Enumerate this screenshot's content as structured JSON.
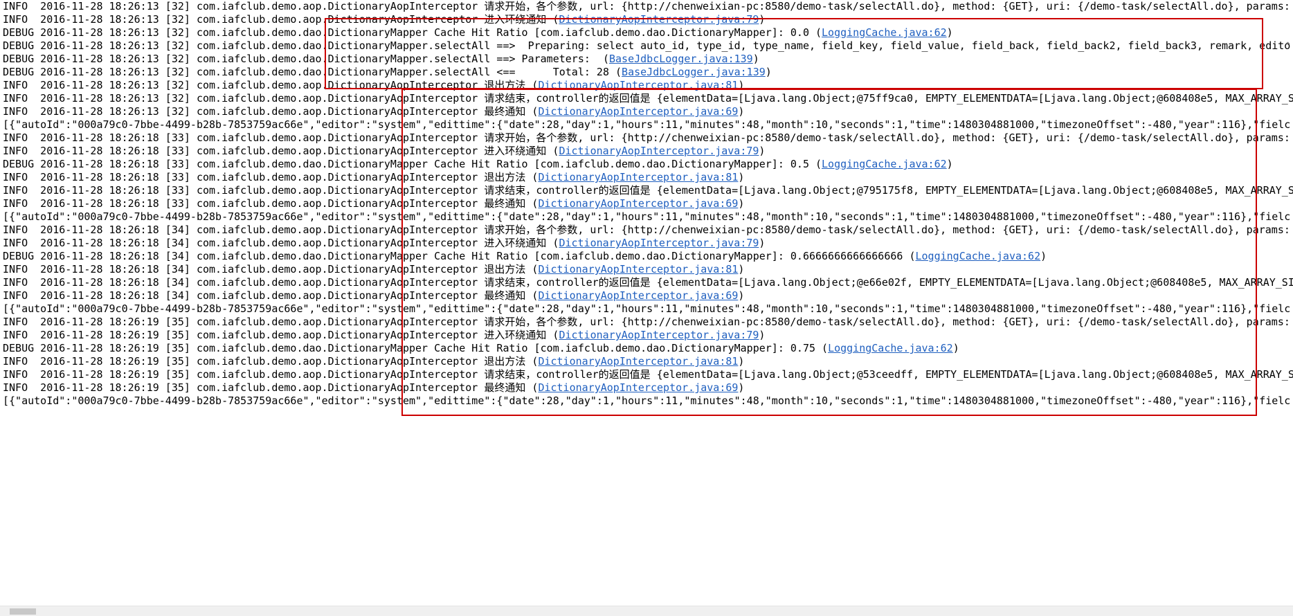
{
  "lines": [
    {
      "prefix": "INFO  2016-11-28 18:26:13 [32] com.iafclub.demo.aop.DictionaryAopInterceptor 请求开始，各个参数, url: {http://chenweixian-pc:8580/demo-task/selectAll.do}, method: {GET}, uri: {/demo-task/selectAll.do}, params: {",
      "link": "",
      "suffix": ""
    },
    {
      "prefix": "INFO  2016-11-28 18:26:13 [32] com.iafclub.demo.aop.DictionaryAopInterceptor 进入环绕通知 (",
      "link": "DictionaryAopInterceptor.java:79",
      "suffix": ")"
    },
    {
      "prefix": "DEBUG 2016-11-28 18:26:13 [32] com.iafclub.demo.dao.DictionaryMapper Cache Hit Ratio [com.iafclub.demo.dao.DictionaryMapper]: 0.0 (",
      "link": "LoggingCache.java:62",
      "suffix": ")"
    },
    {
      "prefix": "DEBUG 2016-11-28 18:26:13 [32] com.iafclub.demo.dao.DictionaryMapper.selectAll ==>  Preparing: select auto_id, type_id, type_name, field_key, field_value, field_back, field_back2, field_back3, remark, edito",
      "link": "",
      "suffix": ""
    },
    {
      "prefix": "DEBUG 2016-11-28 18:26:13 [32] com.iafclub.demo.dao.DictionaryMapper.selectAll ==> Parameters:  (",
      "link": "BaseJdbcLogger.java:139",
      "suffix": ")"
    },
    {
      "prefix": "DEBUG 2016-11-28 18:26:13 [32] com.iafclub.demo.dao.DictionaryMapper.selectAll <==      Total: 28 (",
      "link": "BaseJdbcLogger.java:139",
      "suffix": ")"
    },
    {
      "prefix": "INFO  2016-11-28 18:26:13 [32] com.iafclub.demo.aop.DictionaryAopInterceptor 退出方法 (",
      "link": "DictionaryAopInterceptor.java:81",
      "suffix": ")"
    },
    {
      "prefix": "INFO  2016-11-28 18:26:13 [32] com.iafclub.demo.aop.DictionaryAopInterceptor 请求结束，controller的返回值是 {elementData=[Ljava.lang.Object;@75ff9ca0, EMPTY_ELEMENTDATA=[Ljava.lang.Object;@608408e5, MAX_ARRAY_SIZE",
      "link": "",
      "suffix": ""
    },
    {
      "prefix": "INFO  2016-11-28 18:26:13 [32] com.iafclub.demo.aop.DictionaryAopInterceptor 最终通知 (",
      "link": "DictionaryAopInterceptor.java:69",
      "suffix": ")"
    },
    {
      "prefix": "[{\"autoId\":\"000a79c0-7bbe-4499-b28b-7853759ac66e\",\"editor\":\"system\",\"edittime\":{\"date\":28,\"day\":1,\"hours\":11,\"minutes\":48,\"month\":10,\"seconds\":1,\"time\":1480304881000,\"timezoneOffset\":-480,\"year\":116},\"fielc",
      "link": "",
      "suffix": ""
    },
    {
      "prefix": "INFO  2016-11-28 18:26:18 [33] com.iafclub.demo.aop.DictionaryAopInterceptor 请求开始，各个参数, url: {http://chenweixian-pc:8580/demo-task/selectAll.do}, method: {GET}, uri: {/demo-task/selectAll.do}, params: {",
      "link": "",
      "suffix": ""
    },
    {
      "prefix": "INFO  2016-11-28 18:26:18 [33] com.iafclub.demo.aop.DictionaryAopInterceptor 进入环绕通知 (",
      "link": "DictionaryAopInterceptor.java:79",
      "suffix": ")"
    },
    {
      "prefix": "DEBUG 2016-11-28 18:26:18 [33] com.iafclub.demo.dao.DictionaryMapper Cache Hit Ratio [com.iafclub.demo.dao.DictionaryMapper]: 0.5 (",
      "link": "LoggingCache.java:62",
      "suffix": ")"
    },
    {
      "prefix": "INFO  2016-11-28 18:26:18 [33] com.iafclub.demo.aop.DictionaryAopInterceptor 退出方法 (",
      "link": "DictionaryAopInterceptor.java:81",
      "suffix": ")"
    },
    {
      "prefix": "INFO  2016-11-28 18:26:18 [33] com.iafclub.demo.aop.DictionaryAopInterceptor 请求结束，controller的返回值是 {elementData=[Ljava.lang.Object;@795175f8, EMPTY_ELEMENTDATA=[Ljava.lang.Object;@608408e5, MAX_ARRAY_SIZE",
      "link": "",
      "suffix": ""
    },
    {
      "prefix": "INFO  2016-11-28 18:26:18 [33] com.iafclub.demo.aop.DictionaryAopInterceptor 最终通知 (",
      "link": "DictionaryAopInterceptor.java:69",
      "suffix": ")"
    },
    {
      "prefix": "[{\"autoId\":\"000a79c0-7bbe-4499-b28b-7853759ac66e\",\"editor\":\"system\",\"edittime\":{\"date\":28,\"day\":1,\"hours\":11,\"minutes\":48,\"month\":10,\"seconds\":1,\"time\":1480304881000,\"timezoneOffset\":-480,\"year\":116},\"fielc",
      "link": "",
      "suffix": ""
    },
    {
      "prefix": "INFO  2016-11-28 18:26:18 [34] com.iafclub.demo.aop.DictionaryAopInterceptor 请求开始，各个参数, url: {http://chenweixian-pc:8580/demo-task/selectAll.do}, method: {GET}, uri: {/demo-task/selectAll.do}, params: {",
      "link": "",
      "suffix": ""
    },
    {
      "prefix": "INFO  2016-11-28 18:26:18 [34] com.iafclub.demo.aop.DictionaryAopInterceptor 进入环绕通知 (",
      "link": "DictionaryAopInterceptor.java:79",
      "suffix": ")"
    },
    {
      "prefix": "DEBUG 2016-11-28 18:26:18 [34] com.iafclub.demo.dao.DictionaryMapper Cache Hit Ratio [com.iafclub.demo.dao.DictionaryMapper]: 0.6666666666666666 (",
      "link": "LoggingCache.java:62",
      "suffix": ")"
    },
    {
      "prefix": "INFO  2016-11-28 18:26:18 [34] com.iafclub.demo.aop.DictionaryAopInterceptor 退出方法 (",
      "link": "DictionaryAopInterceptor.java:81",
      "suffix": ")"
    },
    {
      "prefix": "INFO  2016-11-28 18:26:18 [34] com.iafclub.demo.aop.DictionaryAopInterceptor 请求结束，controller的返回值是 {elementData=[Ljava.lang.Object;@e66e02f, EMPTY_ELEMENTDATA=[Ljava.lang.Object;@608408e5, MAX_ARRAY_SIZE=",
      "link": "",
      "suffix": ""
    },
    {
      "prefix": "INFO  2016-11-28 18:26:18 [34] com.iafclub.demo.aop.DictionaryAopInterceptor 最终通知 (",
      "link": "DictionaryAopInterceptor.java:69",
      "suffix": ")"
    },
    {
      "prefix": "[{\"autoId\":\"000a79c0-7bbe-4499-b28b-7853759ac66e\",\"editor\":\"system\",\"edittime\":{\"date\":28,\"day\":1,\"hours\":11,\"minutes\":48,\"month\":10,\"seconds\":1,\"time\":1480304881000,\"timezoneOffset\":-480,\"year\":116},\"fielc",
      "link": "",
      "suffix": ""
    },
    {
      "prefix": "INFO  2016-11-28 18:26:19 [35] com.iafclub.demo.aop.DictionaryAopInterceptor 请求开始，各个参数, url: {http://chenweixian-pc:8580/demo-task/selectAll.do}, method: {GET}, uri: {/demo-task/selectAll.do}, params: {",
      "link": "",
      "suffix": ""
    },
    {
      "prefix": "INFO  2016-11-28 18:26:19 [35] com.iafclub.demo.aop.DictionaryAopInterceptor 进入环绕通知 (",
      "link": "DictionaryAopInterceptor.java:79",
      "suffix": ")"
    },
    {
      "prefix": "DEBUG 2016-11-28 18:26:19 [35] com.iafclub.demo.dao.DictionaryMapper Cache Hit Ratio [com.iafclub.demo.dao.DictionaryMapper]: 0.75 (",
      "link": "LoggingCache.java:62",
      "suffix": ")"
    },
    {
      "prefix": "INFO  2016-11-28 18:26:19 [35] com.iafclub.demo.aop.DictionaryAopInterceptor 退出方法 (",
      "link": "DictionaryAopInterceptor.java:81",
      "suffix": ")"
    },
    {
      "prefix": "INFO  2016-11-28 18:26:19 [35] com.iafclub.demo.aop.DictionaryAopInterceptor 请求结束，controller的返回值是 {elementData=[Ljava.lang.Object;@53ceedff, EMPTY_ELEMENTDATA=[Ljava.lang.Object;@608408e5, MAX_ARRAY_SIZE",
      "link": "",
      "suffix": ""
    },
    {
      "prefix": "INFO  2016-11-28 18:26:19 [35] com.iafclub.demo.aop.DictionaryAopInterceptor 最终通知 (",
      "link": "DictionaryAopInterceptor.java:69",
      "suffix": ")"
    },
    {
      "prefix": "[{\"autoId\":\"000a79c0-7bbe-4499-b28b-7853759ac66e\",\"editor\":\"system\",\"edittime\":{\"date\":28,\"day\":1,\"hours\":11,\"minutes\":48,\"month\":10,\"seconds\":1,\"time\":1480304881000,\"timezoneOffset\":-480,\"year\":116},\"fielc",
      "link": "",
      "suffix": ""
    }
  ],
  "colors": {
    "text": "#000000",
    "link": "#1f5fbf",
    "highlight_border": "#cc0000",
    "scrollbar_track": "#f0f0f0",
    "scrollbar_thumb": "#c8c8c8"
  },
  "icons": {
    "scroll_up": "chevron-up-icon"
  },
  "scroll_up_glyph": "^"
}
